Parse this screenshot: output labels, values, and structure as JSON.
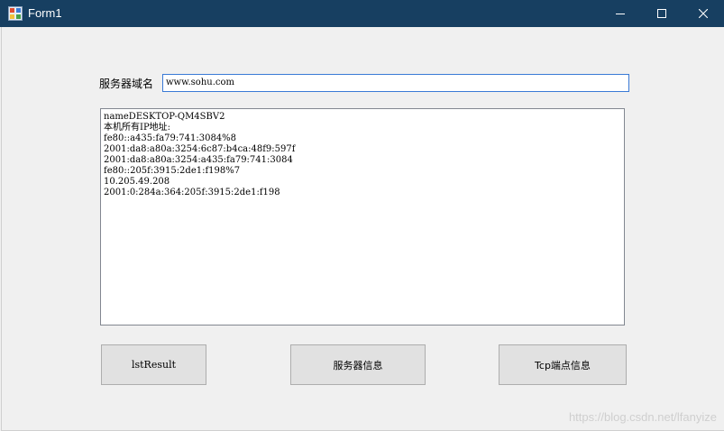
{
  "window": {
    "title": "Form1",
    "controls": [
      "minimize-icon",
      "maximize-icon",
      "close-icon"
    ]
  },
  "form": {
    "domain_label": "服务器域名",
    "domain_value": "www.sohu.com"
  },
  "result_list": {
    "lines": [
      "nameDESKTOP-QM4SBV2",
      "本机所有IP地址:",
      "fe80::a435:fa79:741:3084%8",
      "2001:da8:a80a:3254:6c87:b4ca:48f9:597f",
      "2001:da8:a80a:3254:a435:fa79:741:3084",
      "fe80::205f:3915:2de1:f198%7",
      "10.205.49.208",
      "2001:0:284a:364:205f:3915:2de1:f198"
    ]
  },
  "buttons": {
    "lst_result": "lstResult",
    "server_info": "服务器信息",
    "tcp_endpoint_info": "Tcp端点信息"
  },
  "watermark": "https://blog.csdn.net/lfanyize"
}
